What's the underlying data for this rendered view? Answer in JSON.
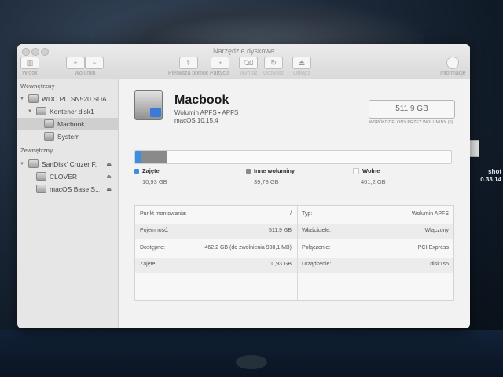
{
  "window_title": "Narzędzie dyskowe",
  "toolbar": {
    "view_label": "Widok",
    "volume_label": "Wolumin",
    "first_aid_label": "Pierwsza pomoc",
    "partition_label": "Partycja",
    "erase_label": "Wymaż",
    "restore_label": "Odtwórz",
    "unmount_label": "Odłącz",
    "info_label": "Informacje"
  },
  "sidebar": {
    "internal_header": "Wewnętrzny",
    "external_header": "Zewnętrzny",
    "items": [
      {
        "label": "WDC PC SN520 SDA..."
      },
      {
        "label": "Kontener disk1"
      },
      {
        "label": "Macbook"
      },
      {
        "label": "System"
      },
      {
        "label": "SanDisk' Cruzer F..."
      },
      {
        "label": "CLOVER"
      },
      {
        "label": "macOS Base S..."
      }
    ]
  },
  "volume": {
    "name": "Macbook",
    "type": "Wolumin APFS • APFS",
    "os": "macOS 10.15.4",
    "size": "511,9 GB",
    "size_caption": "WSPÓŁDZIELONY PRZEZ WOLUMINY (5)"
  },
  "usage": {
    "used_fraction": 0.021,
    "other_fraction": 0.078,
    "colors": {
      "used": "#3a8ee6",
      "other": "#8a8a8a",
      "free": "#fafafa"
    },
    "legend": [
      {
        "label": "Zajęte",
        "value": "10,93 GB"
      },
      {
        "label": "Inne woluminy",
        "value": "39,78 GB"
      },
      {
        "label": "Wolne",
        "value": "461,2 GB"
      }
    ]
  },
  "info": {
    "left": [
      {
        "label": "Punkt montowania:",
        "value": "/"
      },
      {
        "label": "Pojemność:",
        "value": "511,9 GB"
      },
      {
        "label": "Dostępne:",
        "value": "462,2 GB (do zwolnienia 998,1 MB)"
      },
      {
        "label": "Zajęte:",
        "value": "10,93 GB"
      }
    ],
    "right": [
      {
        "label": "Typ:",
        "value": "Wolumin APFS"
      },
      {
        "label": "Właściciele:",
        "value": "Włączony"
      },
      {
        "label": "Połączenie:",
        "value": "PCI-Express"
      },
      {
        "label": "Urządzenie:",
        "value": "disk1s5"
      }
    ]
  },
  "desktop": {
    "label1": "shot",
    "label2": "0.33.14"
  }
}
